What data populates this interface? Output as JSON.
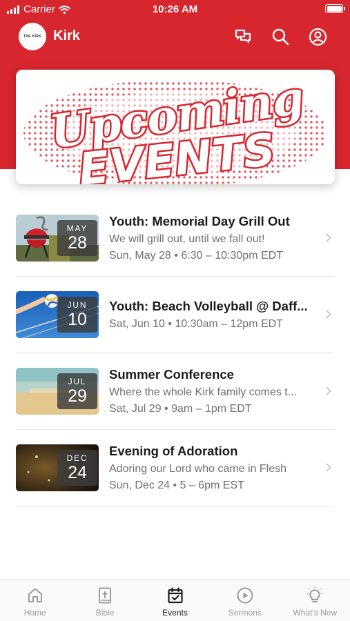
{
  "status_bar": {
    "carrier": "Carrier",
    "time": "10:26 AM"
  },
  "header": {
    "app_name": "Kirk",
    "logo_text": "THE KIRK"
  },
  "banner": {
    "line1": "Upcoming",
    "line2": "EVENTS",
    "brand_color": "#d8262f"
  },
  "events": [
    {
      "month": "MAY",
      "day": "28",
      "title": "Youth: Memorial Day Grill Out",
      "description": "We will grill out, until we fall out!",
      "when": "Sun, May 28 • 6:30 – 10:30pm EDT",
      "thumb_icon": "grill-image"
    },
    {
      "month": "JUN",
      "day": "10",
      "title": "Youth: Beach Volleyball @ Daff...",
      "description": "",
      "when": "Sat, Jun 10 • 10:30am – 12pm EDT",
      "thumb_icon": "volleyball-image"
    },
    {
      "month": "JUL",
      "day": "29",
      "title": "Summer Conference",
      "description": "Where the whole Kirk family comes t...",
      "when": "Sat, Jul 29 • 9am – 1pm EDT",
      "thumb_icon": "beach-image"
    },
    {
      "month": "DEC",
      "day": "24",
      "title": "Evening of Adoration",
      "description": "Adoring our Lord who came in Flesh",
      "when": "Sun, Dec 24 • 5 – 6pm EST",
      "thumb_icon": "adoration-image"
    }
  ],
  "tabs": [
    {
      "label": "Home",
      "icon": "home-icon",
      "active": false
    },
    {
      "label": "Bible",
      "icon": "bible-icon",
      "active": false
    },
    {
      "label": "Events",
      "icon": "calendar-icon",
      "active": true
    },
    {
      "label": "Sermons",
      "icon": "play-icon",
      "active": false
    },
    {
      "label": "What's New",
      "icon": "lightbulb-icon",
      "active": false
    }
  ]
}
